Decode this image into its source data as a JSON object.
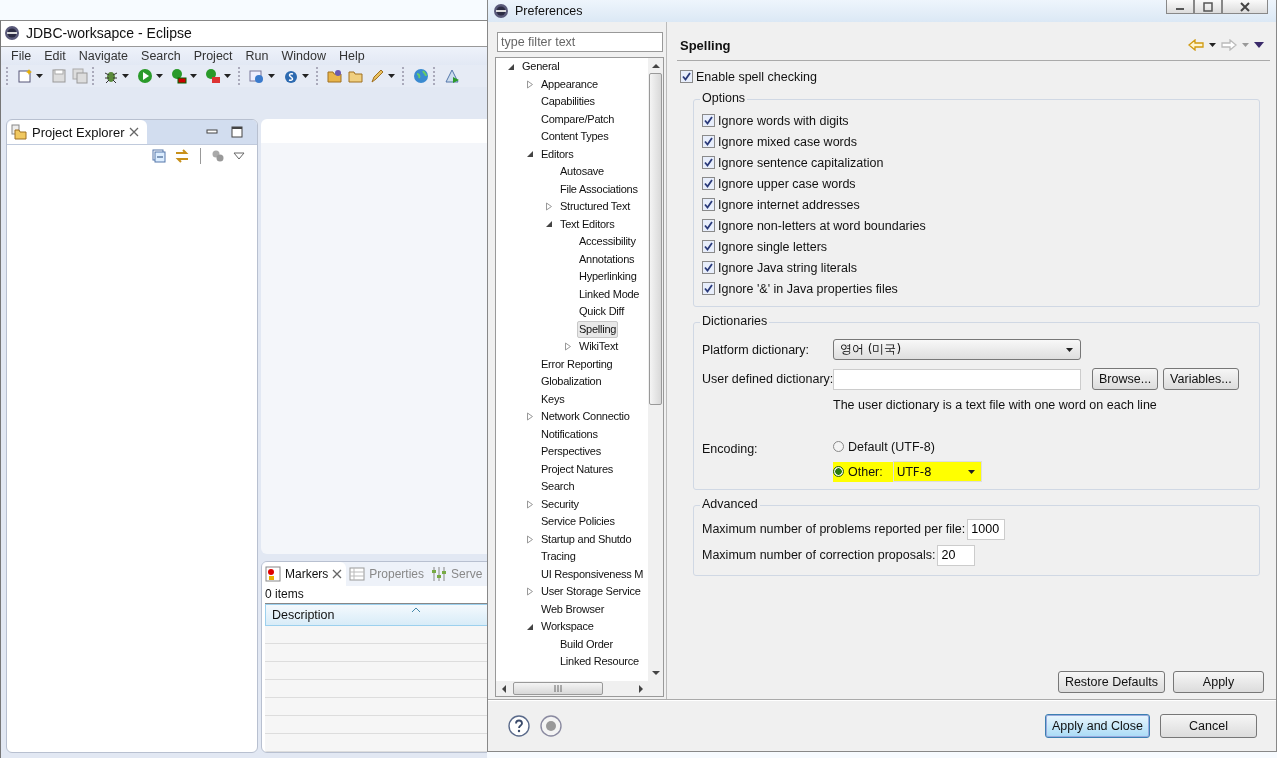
{
  "eclipse": {
    "title": "JDBC-worksapce - Eclipse",
    "menu": [
      "File",
      "Edit",
      "Navigate",
      "Search",
      "Project",
      "Run",
      "Window",
      "Help"
    ],
    "project_explorer": {
      "tab": "Project Explorer"
    },
    "markers": {
      "tabs": [
        {
          "label": "Markers",
          "selected": true
        },
        {
          "label": "Properties",
          "selected": false
        },
        {
          "label": "Serve",
          "selected": false
        }
      ],
      "count": "0 items",
      "columns": [
        "Description"
      ]
    }
  },
  "preferences": {
    "title": "Preferences",
    "filter": {
      "placeholder": "type filter text"
    },
    "tree": [
      {
        "label": "General",
        "selected": false,
        "expanded": true,
        "children": [
          {
            "label": "Appearance",
            "selected": false,
            "expanded": false
          },
          {
            "label": "Capabilities",
            "selected": false
          },
          {
            "label": "Compare/Patch",
            "selected": false
          },
          {
            "label": "Content Types",
            "selected": false
          },
          {
            "label": "Editors",
            "selected": false,
            "expanded": true,
            "children": [
              {
                "label": "Autosave",
                "selected": false
              },
              {
                "label": "File Associations",
                "selected": false
              },
              {
                "label": "Structured Text",
                "selected": false,
                "expanded": false
              },
              {
                "label": "Text Editors",
                "selected": false,
                "expanded": true,
                "children": [
                  {
                    "label": "Accessibility",
                    "selected": false
                  },
                  {
                    "label": "Annotations",
                    "selected": false
                  },
                  {
                    "label": "Hyperlinking",
                    "selected": false
                  },
                  {
                    "label": "Linked Mode",
                    "selected": false
                  },
                  {
                    "label": "Quick Diff",
                    "selected": false
                  },
                  {
                    "label": "Spelling",
                    "selected": true
                  },
                  {
                    "label": "WikiText",
                    "selected": false,
                    "expanded": false
                  }
                ]
              }
            ]
          },
          {
            "label": "Error Reporting",
            "selected": false
          },
          {
            "label": "Globalization",
            "selected": false
          },
          {
            "label": "Keys",
            "selected": false
          },
          {
            "label": "Network Connectio",
            "selected": false,
            "expanded": false
          },
          {
            "label": "Notifications",
            "selected": false
          },
          {
            "label": "Perspectives",
            "selected": false
          },
          {
            "label": "Project Natures",
            "selected": false
          },
          {
            "label": "Search",
            "selected": false
          },
          {
            "label": "Security",
            "selected": false,
            "expanded": false
          },
          {
            "label": "Service Policies",
            "selected": false
          },
          {
            "label": "Startup and Shutdo",
            "selected": false,
            "expanded": false
          },
          {
            "label": "Tracing",
            "selected": false
          },
          {
            "label": "UI Responsiveness M",
            "selected": false
          },
          {
            "label": "User Storage Service",
            "selected": false,
            "expanded": false
          },
          {
            "label": "Web Browser",
            "selected": false
          },
          {
            "label": "Workspace",
            "selected": false,
            "expanded": true,
            "children": [
              {
                "label": "Build Order",
                "selected": false
              },
              {
                "label": "Linked Resource",
                "selected": false
              }
            ]
          }
        ]
      }
    ],
    "page": {
      "title": "Spelling",
      "enable": {
        "label": "Enable spell checking",
        "checked": true
      },
      "options": {
        "title": "Options",
        "items": [
          {
            "label": "Ignore words with digits",
            "checked": true
          },
          {
            "label": "Ignore mixed case words",
            "checked": true
          },
          {
            "label": "Ignore sentence capitalization",
            "checked": true
          },
          {
            "label": "Ignore upper case words",
            "checked": true
          },
          {
            "label": "Ignore internet addresses",
            "checked": true
          },
          {
            "label": "Ignore non-letters at word boundaries",
            "checked": true
          },
          {
            "label": "Ignore single letters",
            "checked": true
          },
          {
            "label": "Ignore Java string literals",
            "checked": true
          },
          {
            "label": "Ignore '&' in Java properties files",
            "checked": true
          }
        ]
      },
      "dictionaries": {
        "title": "Dictionaries",
        "platform": {
          "label": "Platform dictionary:",
          "value": "영어 (미국)"
        },
        "user": {
          "label": "User defined dictionary:",
          "buttons": [
            "Browse...",
            "Variables..."
          ]
        },
        "hint": "The user dictionary is a text file with one word on each line",
        "encoding": {
          "label": "Encoding:",
          "options": [
            {
              "label": "Default (UTF-8)",
              "selected": false,
              "highlighted": false
            },
            {
              "label": "Other:",
              "selected": true,
              "highlighted": true,
              "value": "UTF-8"
            }
          ]
        }
      },
      "advanced": {
        "title": "Advanced",
        "fields": [
          {
            "label": "Maximum number of problems reported per file:",
            "value": "1000"
          },
          {
            "label": "Maximum number of correction proposals:",
            "value": "20"
          }
        ]
      },
      "buttons": [
        "Restore Defaults",
        "Apply"
      ]
    },
    "footer_buttons": [
      {
        "label": "Apply and Close",
        "default": true
      },
      {
        "label": "Cancel",
        "default": false
      }
    ]
  }
}
